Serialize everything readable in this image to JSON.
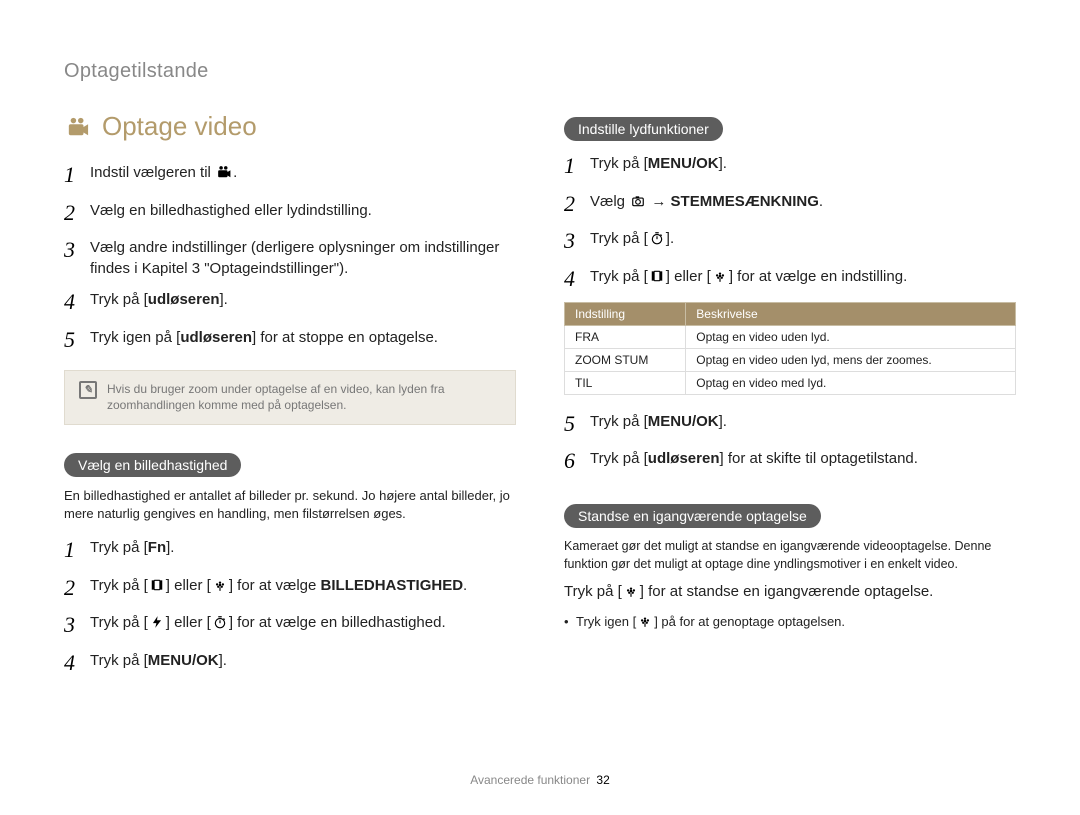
{
  "section_title": "Optagetilstande",
  "heading": "Optage video",
  "left": {
    "main_steps": [
      {
        "n": "1",
        "parts": [
          {
            "t": "Indstil vælgeren til "
          },
          {
            "icon": "videocam-small"
          },
          {
            "t": "."
          }
        ]
      },
      {
        "n": "2",
        "parts": [
          {
            "t": "Vælg en billedhastighed eller lydindstilling."
          }
        ]
      },
      {
        "n": "3",
        "parts": [
          {
            "t": "Vælg andre indstillinger (derligere oplysninger om indstillinger findes i Kapitel 3 \"Optageindstillinger\")."
          }
        ]
      },
      {
        "n": "4",
        "parts": [
          {
            "t": "Tryk på ["
          },
          {
            "b": "udløseren"
          },
          {
            "t": "]."
          }
        ]
      },
      {
        "n": "5",
        "parts": [
          {
            "t": "Tryk igen på ["
          },
          {
            "b": "udløseren"
          },
          {
            "t": "] for at stoppe en optagelse."
          }
        ]
      }
    ],
    "note": "Hvis du bruger zoom under optagelse af en video, kan lyden fra zoomhandlingen komme med på optagelsen.",
    "sub1_pill": "Vælg en billedhastighed",
    "sub1_intro": "En billedhastighed er antallet af billeder pr. sekund. Jo højere antal billeder, jo mere naturlig gengives en handling, men filstørrelsen øges.",
    "sub1_steps": [
      {
        "n": "1",
        "parts": [
          {
            "t": "Tryk på ["
          },
          {
            "b": "Fn"
          },
          {
            "t": "]."
          }
        ]
      },
      {
        "n": "2",
        "parts": [
          {
            "t": "Tryk på ["
          },
          {
            "icon": "macro-left"
          },
          {
            "t": "] eller ["
          },
          {
            "icon": "flower-down"
          },
          {
            "t": "] for at vælge "
          },
          {
            "b": "BILLEDHASTIGHED"
          },
          {
            "t": "."
          }
        ]
      },
      {
        "n": "3",
        "parts": [
          {
            "t": "Tryk på ["
          },
          {
            "icon": "flash"
          },
          {
            "t": "] eller ["
          },
          {
            "icon": "timer"
          },
          {
            "t": "] for at vælge en billedhastighed."
          }
        ]
      },
      {
        "n": "4",
        "parts": [
          {
            "t": "Tryk på ["
          },
          {
            "b": "MENU/OK"
          },
          {
            "t": "]."
          }
        ]
      }
    ]
  },
  "right": {
    "sub2_pill": "Indstille lydfunktioner",
    "sub2_steps_a": [
      {
        "n": "1",
        "parts": [
          {
            "t": "Tryk på ["
          },
          {
            "b": "MENU/OK"
          },
          {
            "t": "]."
          }
        ]
      },
      {
        "n": "2",
        "parts": [
          {
            "t": "Vælg "
          },
          {
            "icon": "camera"
          },
          {
            "t": " → "
          },
          {
            "b": "STEMMESÆNKNING"
          },
          {
            "t": "."
          }
        ]
      },
      {
        "n": "3",
        "parts": [
          {
            "t": "Tryk på ["
          },
          {
            "icon": "timer"
          },
          {
            "t": "]."
          }
        ]
      },
      {
        "n": "4",
        "parts": [
          {
            "t": "Tryk på ["
          },
          {
            "icon": "macro-left"
          },
          {
            "t": "] eller ["
          },
          {
            "icon": "flower-down"
          },
          {
            "t": "] for at vælge en indstilling."
          }
        ]
      }
    ],
    "table": {
      "headers": [
        "Indstilling",
        "Beskrivelse"
      ],
      "rows": [
        [
          "FRA",
          "Optag en video uden lyd."
        ],
        [
          "ZOOM STUM",
          "Optag en video uden lyd, mens der zoomes."
        ],
        [
          "TIL",
          "Optag en video med lyd."
        ]
      ]
    },
    "sub2_steps_b": [
      {
        "n": "5",
        "parts": [
          {
            "t": "Tryk på ["
          },
          {
            "b": "MENU/OK"
          },
          {
            "t": "]."
          }
        ]
      },
      {
        "n": "6",
        "parts": [
          {
            "t": "Tryk på ["
          },
          {
            "b": "udløseren"
          },
          {
            "t": "] for at skifte til optagetilstand."
          }
        ]
      }
    ],
    "sub3_pill": "Standse en igangværende optagelse",
    "sub3_intro": "Kameraet gør det muligt at standse en igangværende videooptagelse. Denne funktion gør det muligt at optage dine yndlingsmotiver i en enkelt video.",
    "sub3_line": [
      {
        "t": "Tryk på ["
      },
      {
        "icon": "flower-down"
      },
      {
        "t": "] for at standse en igangværende optagelse."
      }
    ],
    "sub3_bullet": [
      {
        "t": "Tryk igen ["
      },
      {
        "icon": "flower-down"
      },
      {
        "t": "] på for at genoptage optagelsen."
      }
    ]
  },
  "footer": {
    "label": "Avancerede funktioner",
    "page": "32"
  }
}
